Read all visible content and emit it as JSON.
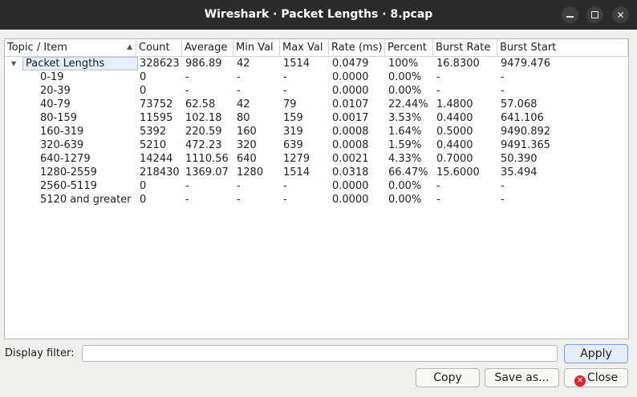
{
  "window": {
    "title": "Wireshark · Packet Lengths · 8.pcap",
    "minimize_icon": "minimize-icon",
    "maximize_icon": "maximize-icon",
    "close_icon": "close-icon"
  },
  "table": {
    "columns": [
      "Topic / Item",
      "Count",
      "Average",
      "Min Val",
      "Max Val",
      "Rate (ms)",
      "Percent",
      "Burst Rate",
      "Burst Start"
    ],
    "sort_indicator": "ascending",
    "parent": [
      "Packet Lengths",
      "328623",
      "986.89",
      "42",
      "1514",
      "0.0479",
      "100%",
      "16.8300",
      "9479.476"
    ],
    "rows": [
      [
        "0-19",
        "0",
        "-",
        "-",
        "-",
        "0.0000",
        "0.00%",
        "-",
        "-"
      ],
      [
        "20-39",
        "0",
        "-",
        "-",
        "-",
        "0.0000",
        "0.00%",
        "-",
        "-"
      ],
      [
        "40-79",
        "73752",
        "62.58",
        "42",
        "79",
        "0.0107",
        "22.44%",
        "1.4800",
        "57.068"
      ],
      [
        "80-159",
        "11595",
        "102.18",
        "80",
        "159",
        "0.0017",
        "3.53%",
        "0.4400",
        "641.106"
      ],
      [
        "160-319",
        "5392",
        "220.59",
        "160",
        "319",
        "0.0008",
        "1.64%",
        "0.5000",
        "9490.892"
      ],
      [
        "320-639",
        "5210",
        "472.23",
        "320",
        "639",
        "0.0008",
        "1.59%",
        "0.4400",
        "9491.365"
      ],
      [
        "640-1279",
        "14244",
        "1110.56",
        "640",
        "1279",
        "0.0021",
        "4.33%",
        "0.7000",
        "50.390"
      ],
      [
        "1280-2559",
        "218430",
        "1369.07",
        "1280",
        "1514",
        "0.0318",
        "66.47%",
        "15.6000",
        "35.494"
      ],
      [
        "2560-5119",
        "0",
        "-",
        "-",
        "-",
        "0.0000",
        "0.00%",
        "-",
        "-"
      ],
      [
        "5120 and greater",
        "0",
        "-",
        "-",
        "-",
        "0.0000",
        "0.00%",
        "-",
        "-"
      ]
    ]
  },
  "filter": {
    "label": "Display filter:",
    "value": "",
    "placeholder": ""
  },
  "buttons": {
    "apply": "Apply",
    "copy": "Copy",
    "save_as": "Save as...",
    "close": "Close"
  },
  "colors": {
    "titlebar": "#2b2b2b",
    "selection": "#e7eef7",
    "close_accent": "#d9232d"
  }
}
